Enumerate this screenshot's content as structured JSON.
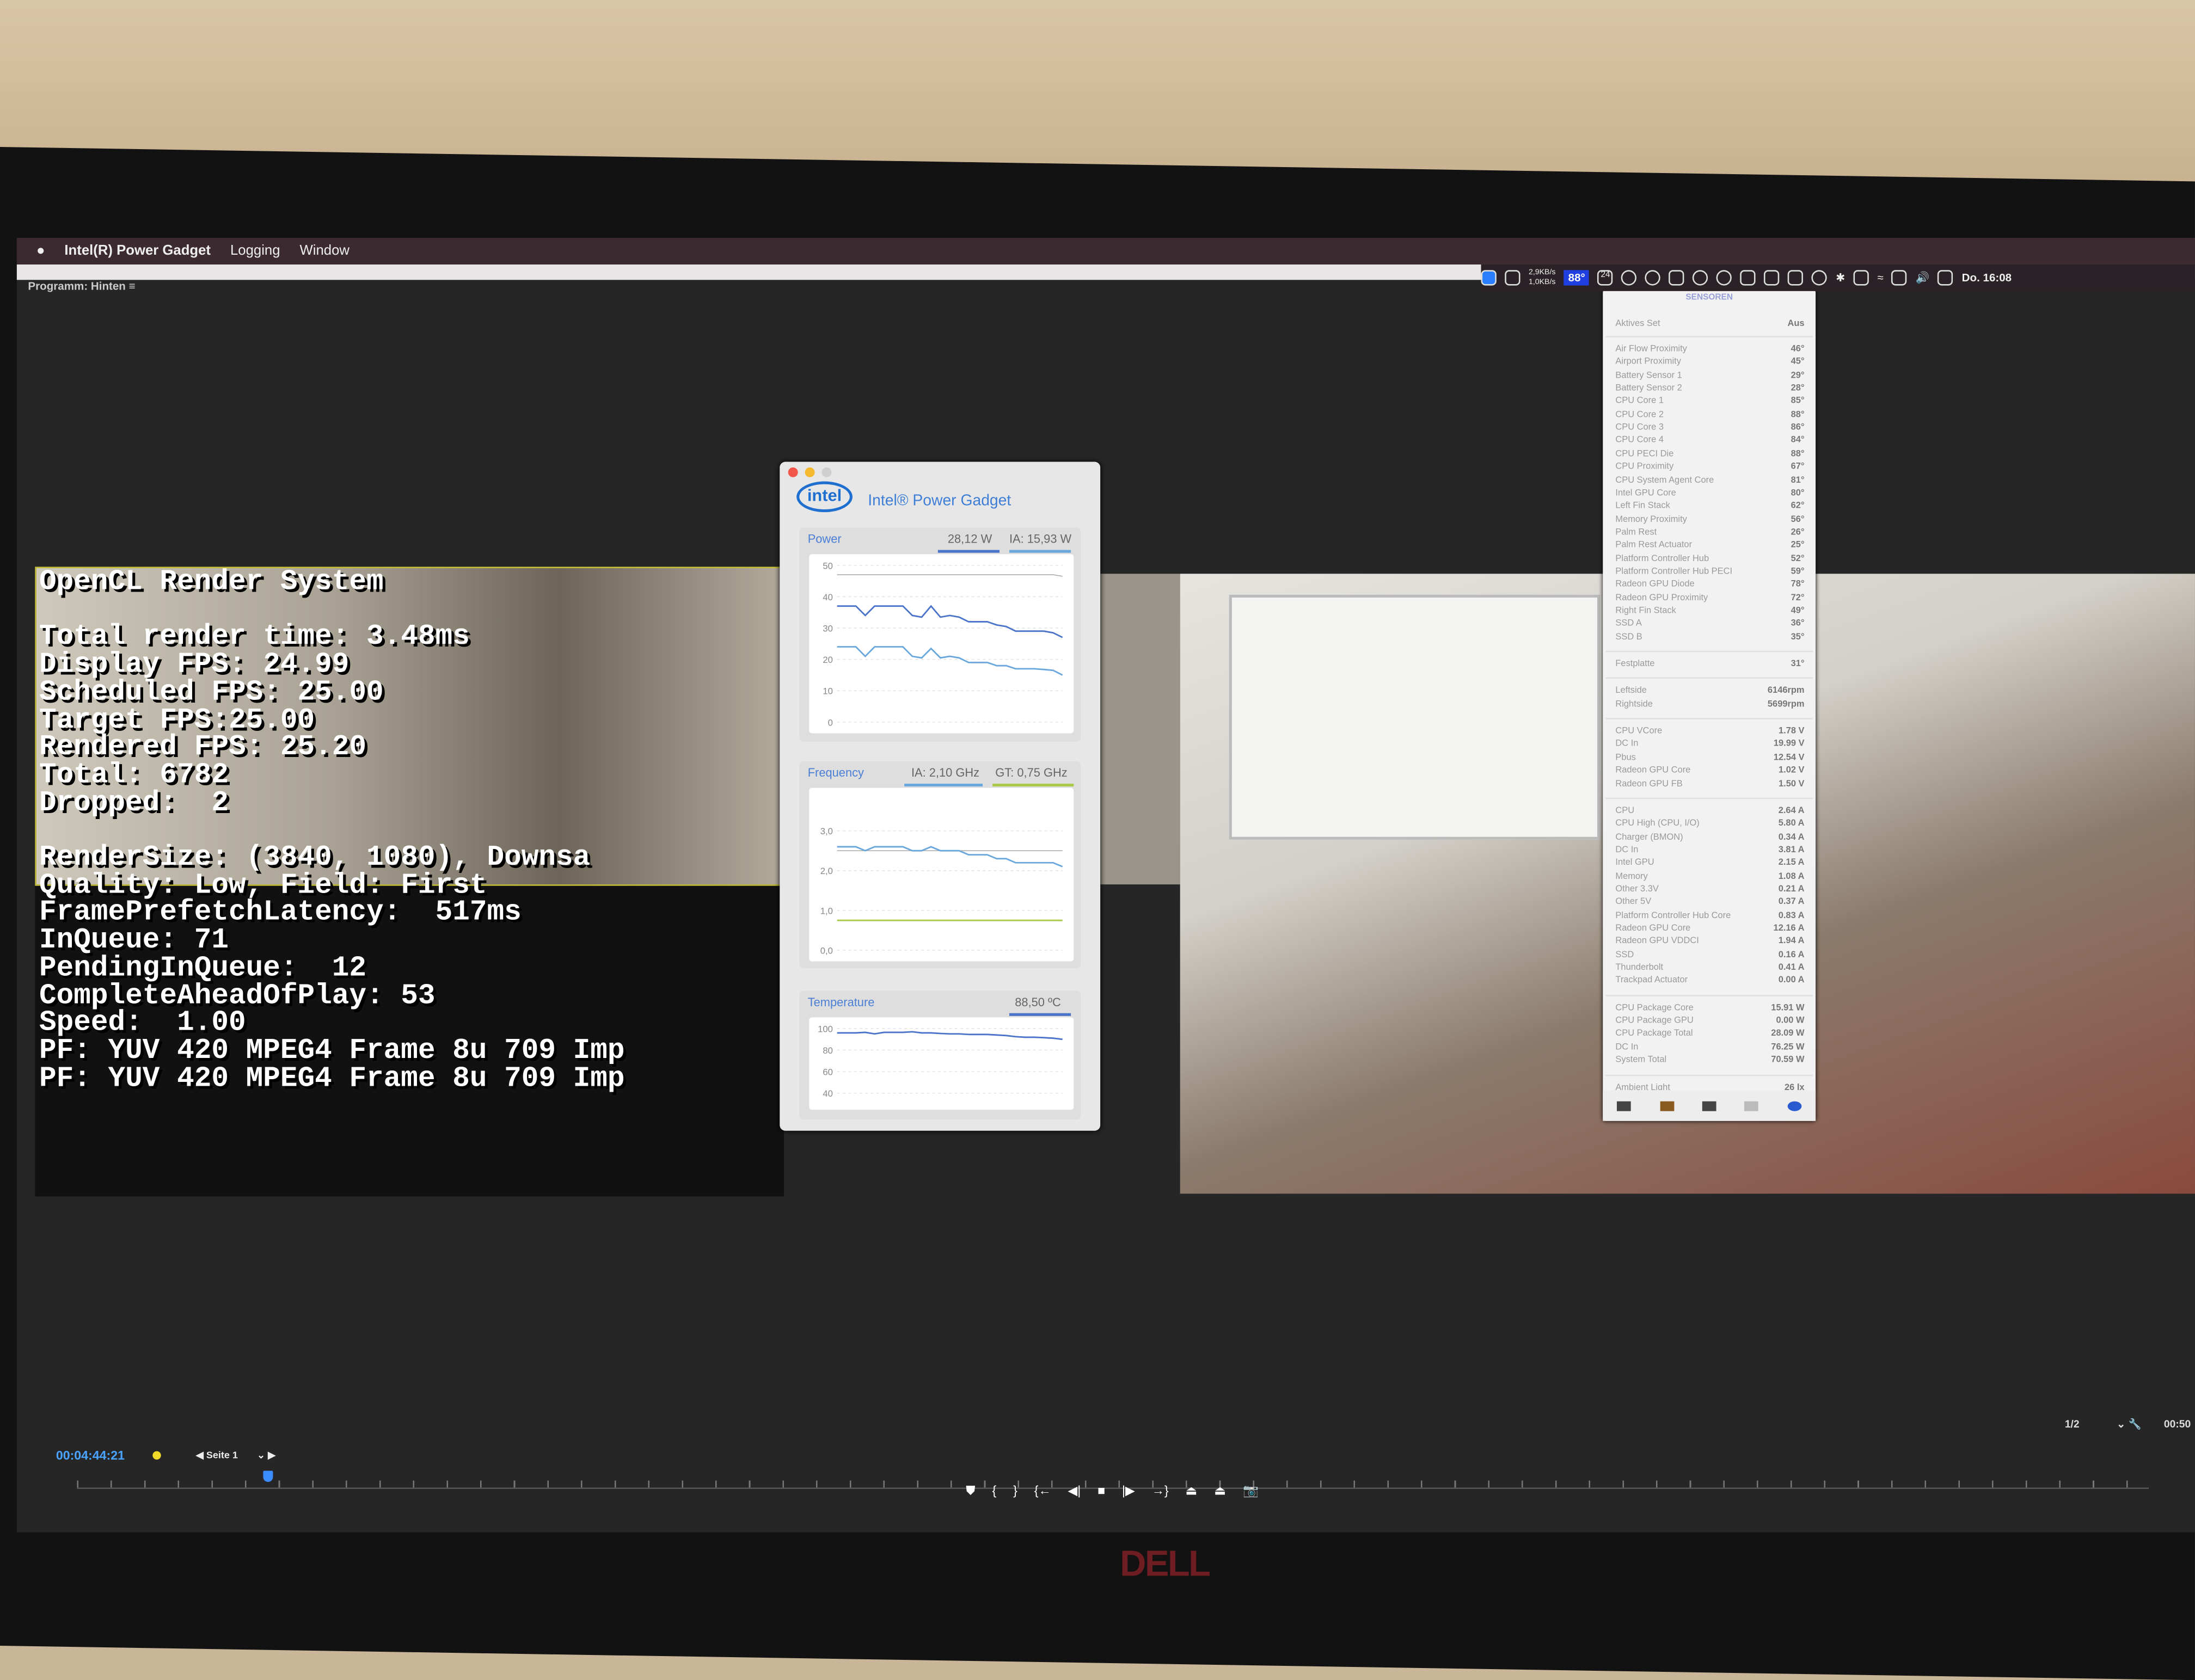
{
  "menubar": {
    "app": "Intel(R) Power Gadget",
    "items": [
      "Logging",
      "Window"
    ],
    "clock": "Do. 16:08",
    "net_up": "2,9KB/s",
    "net_down": "1,0KB/s",
    "sensor_temp": "88°",
    "calendar_day": "24"
  },
  "panel_label": "Programm: Hinten",
  "overlay": {
    "lines": [
      "OpenCL Render System",
      "",
      "Total render time: 3.48ms",
      "Display FPS: 24.99",
      "Scheduled FPS: 25.00",
      "Target FPS:25.00",
      "Rendered FPS: 25.20",
      "Total: 6782",
      "Dropped:  2",
      "",
      "RenderSize: (3840, 1080), Downsa",
      "Quality: Low, Field: First",
      "FramePrefetchLatency:  517ms",
      "InQueue: 71",
      "PendingInQueue:  12",
      "CompleteAheadOfPlay: 53",
      "Speed:  1.00",
      "PF: YUV 420 MPEG4 Frame 8u 709 Imp",
      "PF: YUV 420 MPEG4 Frame 8u 709 Imp"
    ]
  },
  "power_gadget": {
    "logo": "intel",
    "title": "Intel® Power Gadget",
    "power": {
      "label": "Power",
      "package": "28,12 W",
      "ia": "IA: 15,93 W"
    },
    "frequency": {
      "label": "Frequency",
      "ia": "IA: 2,10 GHz",
      "gt": "GT: 0,75 GHz"
    },
    "temperature": {
      "label": "Temperature",
      "value": "88,50 ºC"
    }
  },
  "chart_data": [
    {
      "type": "line",
      "title": "Power",
      "ylim": [
        0,
        50
      ],
      "yticks": [
        "50",
        "40",
        "30",
        "20",
        "10",
        "0"
      ],
      "grid": true,
      "series": [
        {
          "name": "limit",
          "color": "#aaaaaa",
          "values": [
            47,
            47,
            47,
            47,
            47,
            47,
            47,
            47,
            47,
            47,
            47,
            47,
            47,
            47,
            47,
            47,
            47,
            47,
            47,
            47,
            47,
            47,
            47,
            47,
            46.5
          ]
        },
        {
          "name": "28,12 W",
          "color": "#4a74c9",
          "values": [
            37,
            37,
            37,
            34,
            37,
            37,
            37,
            37,
            34,
            33.5,
            37,
            33.5,
            34,
            33.5,
            32,
            32,
            32,
            31,
            30.5,
            29,
            29,
            29,
            29,
            28.5,
            27
          ]
        },
        {
          "name": "IA: 15,93 W",
          "color": "#6aa7dc",
          "values": [
            24,
            24,
            24,
            21,
            24,
            24,
            24,
            24,
            21,
            20.5,
            23.5,
            20.5,
            21,
            20.5,
            19,
            19,
            19,
            18,
            18,
            17,
            17,
            17,
            16.8,
            16.5,
            15
          ]
        }
      ]
    },
    {
      "type": "line",
      "title": "Frequency",
      "ylim": [
        0,
        3.8
      ],
      "yticks": [
        "3,0",
        "2,0",
        "1,0",
        "0,0"
      ],
      "grid": true,
      "series": [
        {
          "name": "base",
          "color": "#aaaaaa",
          "values": [
            2.5,
            2.5,
            2.5,
            2.5,
            2.5,
            2.5,
            2.5,
            2.5,
            2.5,
            2.5,
            2.5,
            2.5,
            2.5,
            2.5,
            2.5,
            2.5,
            2.5,
            2.5,
            2.5,
            2.5,
            2.5,
            2.5,
            2.5,
            2.5,
            2.5
          ]
        },
        {
          "name": "IA: 2,10 GHz",
          "color": "#6aa7dc",
          "values": [
            2.6,
            2.6,
            2.6,
            2.5,
            2.6,
            2.6,
            2.6,
            2.6,
            2.5,
            2.5,
            2.6,
            2.5,
            2.5,
            2.5,
            2.4,
            2.4,
            2.4,
            2.3,
            2.3,
            2.2,
            2.2,
            2.2,
            2.2,
            2.2,
            2.1
          ]
        },
        {
          "name": "GT: 0,75 GHz",
          "color": "#a9c94a",
          "values": [
            0.75,
            0.75,
            0.75,
            0.75,
            0.75,
            0.75,
            0.75,
            0.75,
            0.75,
            0.75,
            0.75,
            0.75,
            0.75,
            0.75,
            0.75,
            0.75,
            0.75,
            0.75,
            0.75,
            0.75,
            0.75,
            0.75,
            0.75,
            0.75,
            0.75
          ]
        }
      ]
    },
    {
      "type": "line",
      "title": "Temperature",
      "ylim": [
        35,
        100
      ],
      "yticks": [
        "100",
        "80",
        "60",
        "40"
      ],
      "grid": true,
      "series": [
        {
          "name": "88,50 ºC",
          "color": "#4a74c9",
          "values": [
            96,
            96,
            96,
            96.5,
            95,
            96.5,
            96.5,
            96.5,
            97,
            96,
            96,
            95.5,
            95,
            95,
            94.5,
            94.5,
            94.5,
            94,
            93.5,
            92.5,
            92,
            92,
            91.5,
            91,
            90
          ]
        }
      ]
    }
  ],
  "sensors": {
    "header": "SENSOREN",
    "active_set": {
      "label": "Aktives Set",
      "value": "Aus"
    },
    "groups": [
      [
        [
          "Air Flow Proximity",
          "46°"
        ],
        [
          "Airport Proximity",
          "45°"
        ],
        [
          "Battery Sensor 1",
          "29°"
        ],
        [
          "Battery Sensor 2",
          "28°"
        ],
        [
          "CPU Core 1",
          "85°"
        ],
        [
          "CPU Core 2",
          "88°"
        ],
        [
          "CPU Core 3",
          "86°"
        ],
        [
          "CPU Core 4",
          "84°"
        ],
        [
          "CPU PECI Die",
          "88°"
        ],
        [
          "CPU Proximity",
          "67°"
        ],
        [
          "CPU System Agent Core",
          "81°"
        ],
        [
          "Intel GPU Core",
          "80°"
        ],
        [
          "Left Fin Stack",
          "62°"
        ],
        [
          "Memory Proximity",
          "56°"
        ],
        [
          "Palm Rest",
          "26°"
        ],
        [
          "Palm Rest Actuator",
          "25°"
        ],
        [
          "Platform Controller Hub",
          "52°"
        ],
        [
          "Platform Controller Hub PECI",
          "59°"
        ],
        [
          "Radeon GPU Diode",
          "78°"
        ],
        [
          "Radeon GPU Proximity",
          "72°"
        ],
        [
          "Right Fin Stack",
          "49°"
        ],
        [
          "SSD A",
          "36°"
        ],
        [
          "SSD B",
          "35°"
        ]
      ],
      [
        [
          "Festplatte",
          "31°"
        ]
      ],
      [
        [
          "Leftside",
          "6146rpm"
        ],
        [
          "Rightside",
          "5699rpm"
        ]
      ],
      [
        [
          "CPU VCore",
          "1.78 V"
        ],
        [
          "DC In",
          "19.99 V"
        ],
        [
          "Pbus",
          "12.54 V"
        ],
        [
          "Radeon GPU Core",
          "1.02 V"
        ],
        [
          "Radeon GPU FB",
          "1.50 V"
        ]
      ],
      [
        [
          "CPU",
          "2.64 A"
        ],
        [
          "CPU High (CPU, I/O)",
          "5.80 A"
        ],
        [
          "Charger (BMON)",
          "0.34 A"
        ],
        [
          "DC In",
          "3.81 A"
        ],
        [
          "Intel GPU",
          "2.15 A"
        ],
        [
          "Memory",
          "1.08 A"
        ],
        [
          "Other 3.3V",
          "0.21 A"
        ],
        [
          "Other 5V",
          "0.37 A"
        ],
        [
          "Platform Controller Hub Core",
          "0.83 A"
        ],
        [
          "Radeon GPU Core",
          "12.16 A"
        ],
        [
          "Radeon GPU VDDCI",
          "1.94 A"
        ],
        [
          "SSD",
          "0.16 A"
        ],
        [
          "Thunderbolt",
          "0.41 A"
        ],
        [
          "Trackpad Actuator",
          "0.00 A"
        ]
      ],
      [
        [
          "CPU Package Core",
          "15.91 W"
        ],
        [
          "CPU Package GPU",
          "0.00 W"
        ],
        [
          "CPU Package Total",
          "28.09 W"
        ],
        [
          "DC In",
          "76.25 W"
        ],
        [
          "System Total",
          "70.59 W"
        ]
      ],
      [
        [
          "Ambient Light",
          "26 lx"
        ]
      ]
    ]
  },
  "timeline": {
    "timecode": "00:04:44:21",
    "page": "Seite 1",
    "page_count": "1/2",
    "end_timecode": "00:50"
  },
  "controls": [
    "marker-icon",
    "in-point-icon",
    "out-point-icon",
    "go-to-in-icon",
    "step-back-icon",
    "stop-icon",
    "step-forward-icon",
    "go-to-out-icon",
    "lift-icon",
    "extract-icon",
    "camera-icon"
  ],
  "monitor_brand": "DELL"
}
